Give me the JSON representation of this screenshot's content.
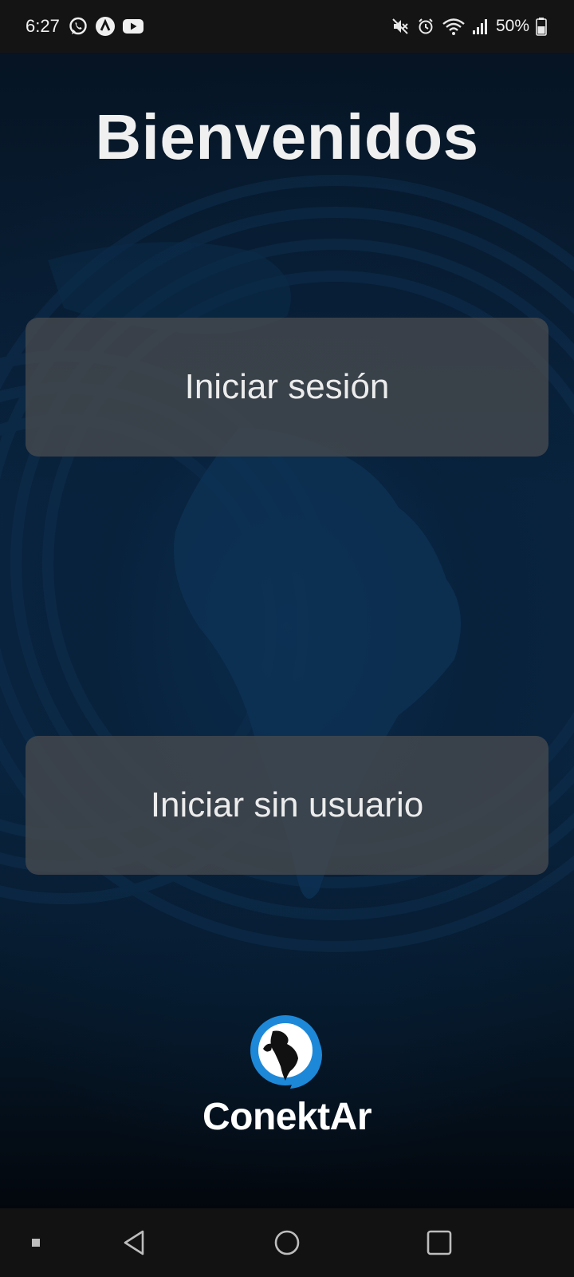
{
  "status_bar": {
    "time": "6:27",
    "battery": "50%",
    "left_icons": [
      "whatsapp-icon",
      "app-notification-icon",
      "youtube-icon"
    ],
    "right_icons": [
      "mute-icon",
      "alarm-icon",
      "wifi-icon",
      "signal-icon",
      "battery-icon"
    ]
  },
  "main": {
    "title": "Bienvenidos",
    "login_button": "Iniciar sesión",
    "guest_button": "Iniciar sin usuario"
  },
  "logo": {
    "text": "ConektAr"
  },
  "nav_bar": {
    "icons": [
      "recents-dot-icon",
      "back-icon",
      "home-icon",
      "overview-icon"
    ]
  },
  "colors": {
    "background_top": "#061423",
    "background_center": "#0a2541",
    "button_bg": "#484a4e",
    "status_bar": "#141414",
    "nav_bar": "#121212",
    "logo_accent": "#1e88d8"
  }
}
